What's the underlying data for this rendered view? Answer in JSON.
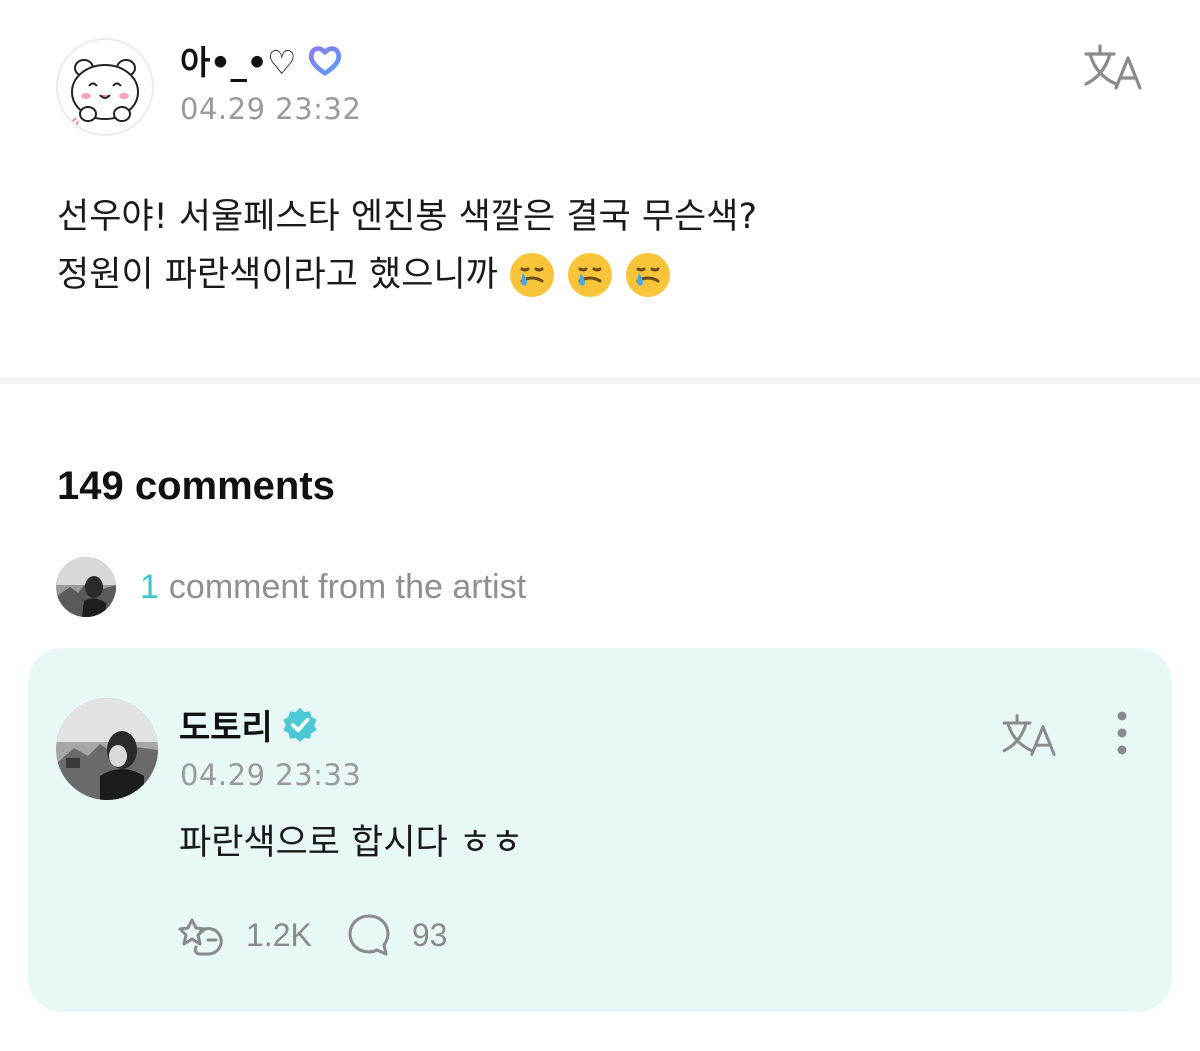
{
  "post": {
    "username": "아•_•♡",
    "timestamp": "04.29 23:32",
    "badge_icon": "heart-badge-icon",
    "body_line1": "선우야! 서울페스타 엔진봉 색깔은 결국 무슨색?",
    "body_line2": "정원이 파란색이라고 했으니까",
    "translate_icon": "translate-icon"
  },
  "comments": {
    "count_label": "149 comments",
    "artist_count": "1",
    "artist_label": "comment from the artist"
  },
  "artist_comment": {
    "author": "도토리",
    "timestamp": "04.29 23:33",
    "text": "파란색으로 합시다 ㅎㅎ",
    "likes": "1.2K",
    "replies": "93",
    "verified_icon": "verified-check-icon",
    "card_color": "#e8f8f6",
    "accent_color": "#39c6c6"
  }
}
